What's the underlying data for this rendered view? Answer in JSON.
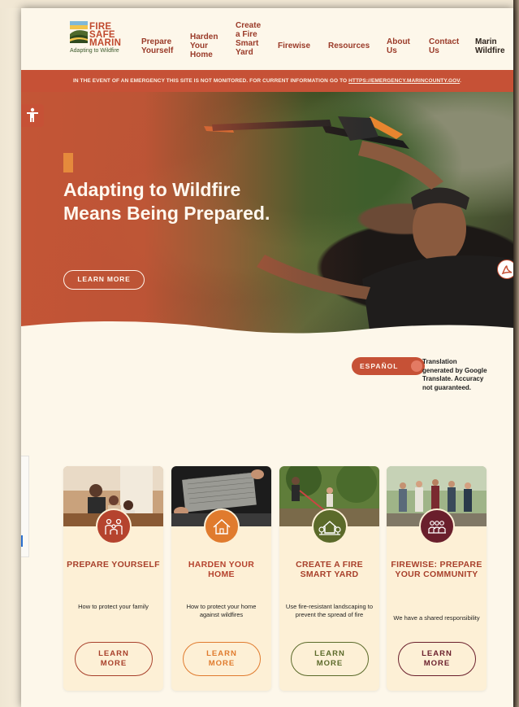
{
  "brand": {
    "logo_lines": [
      "FIRE",
      "SAFE",
      "MARIN"
    ],
    "tagline": "Adapting to Wildfire"
  },
  "nav": {
    "items": [
      {
        "label": "Prepare\nYourself"
      },
      {
        "label": "Harden\nYour\nHome"
      },
      {
        "label": "Create\na Fire\nSmart\nYard"
      },
      {
        "label": "Firewise"
      },
      {
        "label": "Resources"
      },
      {
        "label": "About\nUs"
      },
      {
        "label": "Contact\nUs"
      },
      {
        "label": "Marin\nWildfire"
      }
    ]
  },
  "alert": {
    "text": "IN THE EVENT OF AN EMERGENCY THIS SITE IS NOT MONITORED. FOR CURRENT INFORMATION GO TO ",
    "link": "HTTPS://EMERGENCY.MARINCOUNTY.GOV",
    "suffix": "."
  },
  "hero": {
    "title": "Adapting to Wildfire Means Being Prepared.",
    "button": "LEARN MORE"
  },
  "translate": {
    "button": "ESPAÑOL",
    "note": "Translation generated by Google Translate. Accuracy not guaranteed."
  },
  "cards": [
    {
      "title": "PREPARE YOURSELF",
      "desc": "How to protect your family",
      "button": "LEARN MORE",
      "accent": "#b5432e",
      "icon": "family-icon"
    },
    {
      "title": "HARDEN YOUR HOME",
      "desc": "How to protect your home against wildfires",
      "button": "LEARN MORE",
      "accent": "#e07b2e",
      "icon": "house-icon"
    },
    {
      "title": "CREATE A FIRE SMART YARD",
      "desc": "Use fire-resistant landscaping to prevent the spread of fire",
      "button": "LEARN MORE",
      "accent": "#5b6a2a",
      "icon": "yard-house-icon"
    },
    {
      "title": "FIREWISE: PREPARE YOUR COMMUNITY",
      "desc": "We have a shared responsibility",
      "button": "LEARN MORE",
      "accent": "#6a1f2c",
      "icon": "community-icon"
    }
  ],
  "colors": {
    "brand_red": "#c65136",
    "cream": "#fdf7ea",
    "card_bg": "#fdf0d6"
  }
}
